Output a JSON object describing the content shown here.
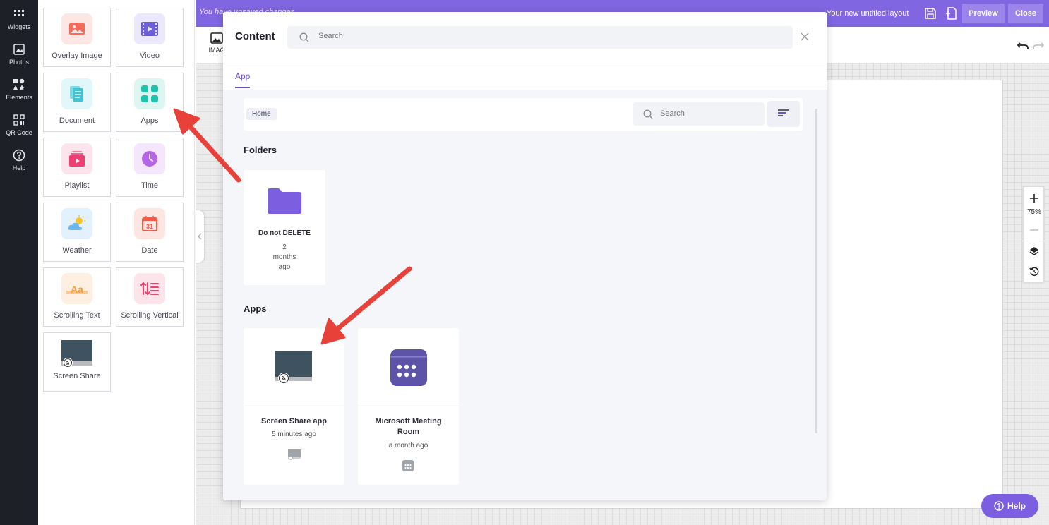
{
  "rail": {
    "items": [
      {
        "label": "Widgets",
        "icon": "grid-icon"
      },
      {
        "label": "Photos",
        "icon": "photo-icon"
      },
      {
        "label": "Elements",
        "icon": "shapes-icon"
      },
      {
        "label": "QR Code",
        "icon": "qr-icon"
      },
      {
        "label": "Help",
        "icon": "help-circle-icon"
      }
    ]
  },
  "widgets": [
    {
      "label": "Overlay Image",
      "color": "#f26b5b",
      "bg": "#fde7e4"
    },
    {
      "label": "Video",
      "color": "#6d5fd9",
      "bg": "#ebe8fb"
    },
    {
      "label": "Document",
      "color": "#3cc6d6",
      "bg": "#e1f7fa"
    },
    {
      "label": "Apps",
      "color": "#1fc2ad",
      "bg": "#ddf6f2"
    },
    {
      "label": "Playlist",
      "color": "#ef3f72",
      "bg": "#fde4ec"
    },
    {
      "label": "Time",
      "color": "#b565e8",
      "bg": "#f4e6fd"
    },
    {
      "label": "Weather",
      "color": "#3fa3e8",
      "bg": "#e2f1fd"
    },
    {
      "label": "Date",
      "color": "#f25a4a",
      "bg": "#fde5e2"
    },
    {
      "label": "Scrolling Text",
      "color": "#f5a040",
      "bg": "#fdefe1"
    },
    {
      "label": "Scrolling Vertical",
      "color": "#ef3f6a",
      "bg": "#fde4ea"
    },
    {
      "label": "Screen Share",
      "color": "#3f5260",
      "bg": "#ffffff"
    }
  ],
  "topbar": {
    "unsaved_text": "You have unsaved changes",
    "layout_name": "Your new untitled layout",
    "preview_label": "Preview",
    "close_label": "Close",
    "accent": "#8066e0"
  },
  "toolbar": {
    "image_label": "IMAG"
  },
  "zoom": {
    "level": "75%"
  },
  "help_button": {
    "label": "Help"
  },
  "modal": {
    "title": "Content",
    "search_placeholder": "Search",
    "tab": "App",
    "breadcrumb": "Home",
    "inner_search_placeholder": "Search",
    "folders_title": "Folders",
    "folders": [
      {
        "name": "Do not DELETE",
        "time_line1": "2",
        "time_line2": "months",
        "time_line3": "ago",
        "color": "#7b5fe0"
      }
    ],
    "apps_title": "Apps",
    "apps": [
      {
        "name": "Screen Share app",
        "time": "5 minutes ago"
      },
      {
        "name_line1": "Microsoft Meeting",
        "name_line2": "Room",
        "time": "a month ago"
      }
    ]
  }
}
